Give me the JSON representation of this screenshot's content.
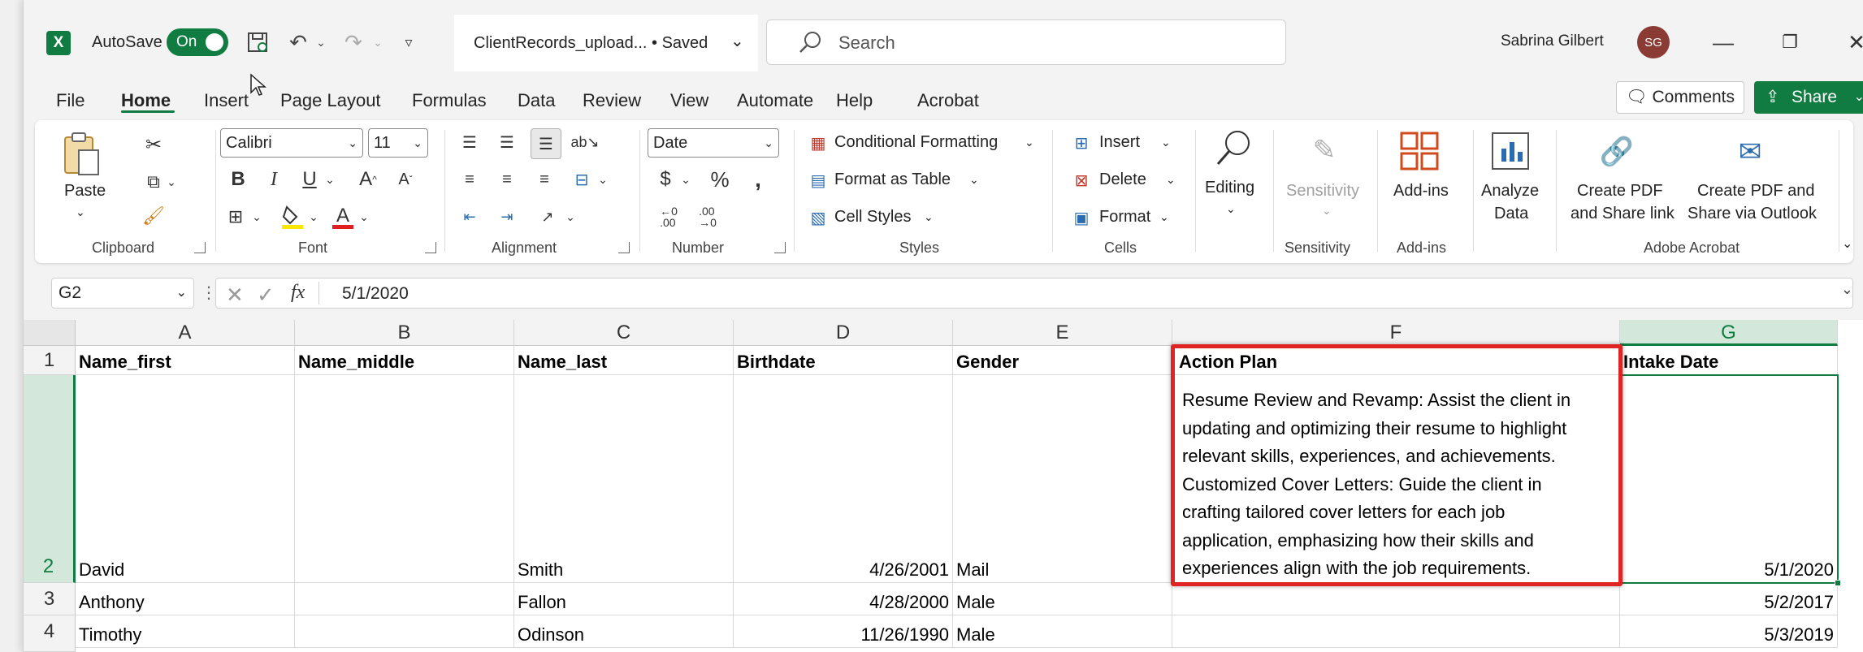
{
  "title_bar": {
    "app_icon": "X",
    "autosave_label": "AutoSave",
    "autosave_state": "On",
    "doc_name": "ClientRecords_upload... • Saved",
    "search_placeholder": "Search",
    "user_name": "Sabrina Gilbert",
    "user_initials": "SG"
  },
  "tabs": [
    "File",
    "Home",
    "Insert",
    "Page Layout",
    "Formulas",
    "Data",
    "Review",
    "View",
    "Automate",
    "Help",
    "Acrobat"
  ],
  "active_tab": "Home",
  "buttons": {
    "comments": "Comments",
    "share": "Share"
  },
  "ribbon": {
    "clipboard": {
      "label": "Clipboard",
      "paste": "Paste"
    },
    "font": {
      "label": "Font",
      "name": "Calibri",
      "size": "11"
    },
    "alignment": {
      "label": "Alignment"
    },
    "number": {
      "label": "Number",
      "format": "Date"
    },
    "styles": {
      "label": "Styles",
      "conditional": "Conditional Formatting",
      "table": "Format as Table",
      "cell_styles": "Cell Styles"
    },
    "cells": {
      "label": "Cells",
      "insert": "Insert",
      "delete": "Delete",
      "format": "Format"
    },
    "editing": {
      "label": "Editing"
    },
    "sensitivity": {
      "label": "Sensitivity",
      "button": "Sensitivity"
    },
    "addins": {
      "label": "Add-ins",
      "button": "Add-ins"
    },
    "analyze": {
      "line1": "Analyze",
      "line2": "Data"
    },
    "acrobat": {
      "label": "Adobe Acrobat",
      "create_link_1": "Create PDF",
      "create_link_2": "and Share link",
      "create_outlook_1": "Create PDF and",
      "create_outlook_2": "Share via Outlook"
    }
  },
  "formula_bar": {
    "cell_ref": "G2",
    "fx": "fx",
    "value": "5/1/2020"
  },
  "columns": [
    "A",
    "B",
    "C",
    "D",
    "E",
    "F",
    "G"
  ],
  "rows": [
    {
      "num": "1",
      "cells": [
        "Name_first",
        "Name_middle",
        "Name_last",
        "Birthdate",
        "Gender",
        "Action Plan",
        "Intake Date"
      ]
    },
    {
      "num": "2",
      "cells": [
        "David",
        "",
        "Smith",
        "4/26/2001",
        "Mail",
        "Resume Review and Revamp: Assist the client in\nupdating and optimizing their resume to highlight\nrelevant skills, experiences, and achievements.\nCustomized Cover Letters: Guide the client in\ncrafting tailored cover letters for each job\napplication, emphasizing how their skills and\nexperiences align with the job requirements.",
        "5/1/2020"
      ]
    },
    {
      "num": "3",
      "cells": [
        "Anthony",
        "",
        "Fallon",
        "4/28/2000",
        "Male",
        "",
        "5/2/2017"
      ]
    },
    {
      "num": "4",
      "cells": [
        "Timothy",
        "",
        "Odinson",
        "11/26/1990",
        "Male",
        "",
        "5/3/2019"
      ]
    }
  ],
  "accent_color": "#107c41",
  "highlight_color": "#e02424"
}
